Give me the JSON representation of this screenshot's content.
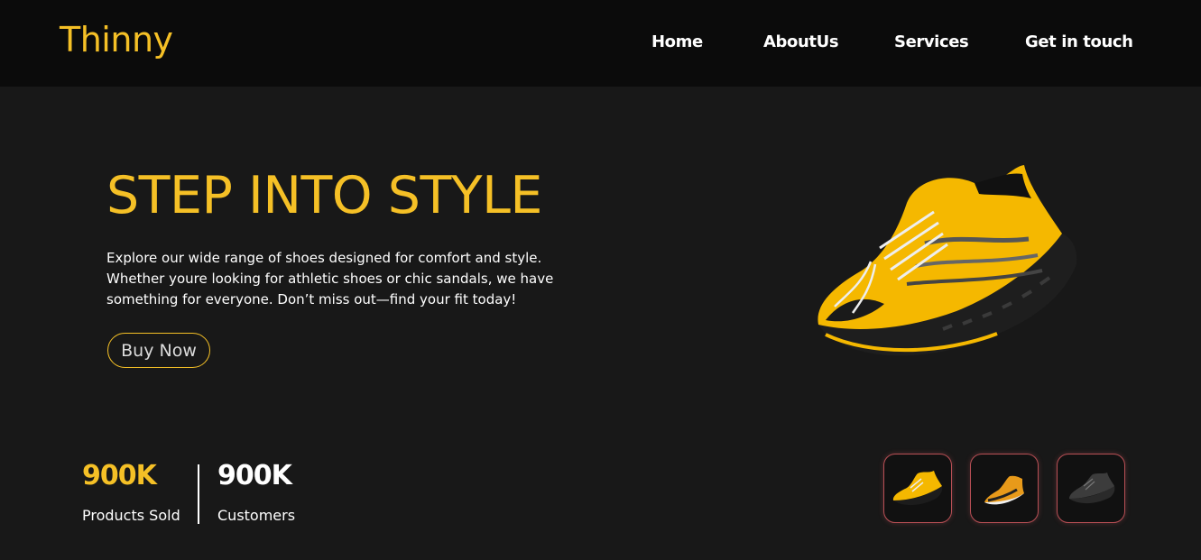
{
  "brand": {
    "name": "Thinny"
  },
  "nav": {
    "items": [
      {
        "label": "Home"
      },
      {
        "label": "AboutUs"
      },
      {
        "label": "Services"
      },
      {
        "label": "Get in touch"
      }
    ]
  },
  "hero": {
    "headline": "STEP INTO STYLE",
    "description": "Explore our wide range of shoes designed for comfort and style. Whether youre looking for athletic shoes or chic sandals, we have something for everyone. Don’t miss out—find your fit today!",
    "cta_label": "Buy Now",
    "image": "yellow-sneaker"
  },
  "stats": [
    {
      "value": "900K",
      "label": "Products Sold",
      "color": "#f5c026"
    },
    {
      "value": "900K",
      "label": "Customers",
      "color": "#ffffff"
    }
  ],
  "thumbnails": [
    {
      "image": "yellow-sneaker"
    },
    {
      "image": "orange-white-sneaker"
    },
    {
      "image": "black-sneaker"
    }
  ],
  "colors": {
    "accent": "#f5c026",
    "header_bg": "#0b0b0b",
    "page_bg": "#181818",
    "thumb_border": "#b84f55"
  }
}
